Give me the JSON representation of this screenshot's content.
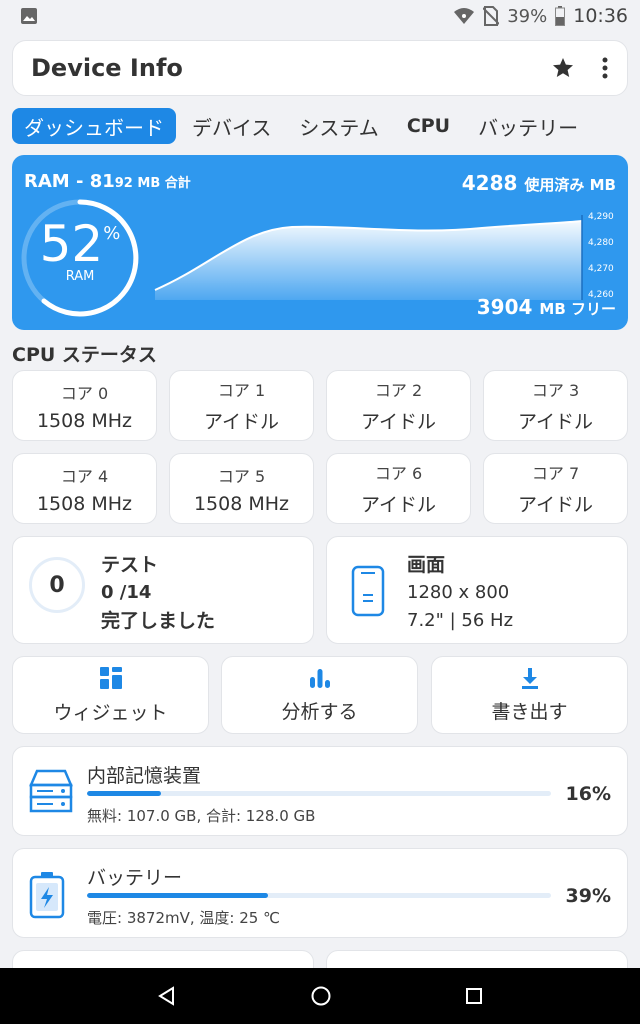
{
  "status_bar": {
    "battery": "39%",
    "time": "10:36"
  },
  "app": {
    "title": "Device Info"
  },
  "tabs": [
    {
      "label": "ダッシュボード"
    },
    {
      "label": "デバイス"
    },
    {
      "label": "システム"
    },
    {
      "label": "CPU"
    },
    {
      "label": "バッテリー"
    }
  ],
  "ram": {
    "title_prefix": "RAM - 81",
    "title_small": "92 MB 合計",
    "used_value": "4288",
    "used_unit": "使用済み MB",
    "free_value": "3904",
    "free_unit": "MB フリー",
    "percent": "52",
    "percent_sign": "%",
    "gauge_label": "RAM",
    "accent": "#2f98ee"
  },
  "chart_data": {
    "type": "area",
    "y_ticks": [
      "4,290",
      "4,280",
      "4,270",
      "4,260"
    ],
    "ylim": [
      4260,
      4290
    ]
  },
  "cpu": {
    "section_title": "CPU ステータス",
    "cores": [
      {
        "name": "コア 0",
        "value": "1508 MHz"
      },
      {
        "name": "コア 1",
        "value": "アイドル"
      },
      {
        "name": "コア 2",
        "value": "アイドル"
      },
      {
        "name": "コア 3",
        "value": "アイドル"
      },
      {
        "name": "コア 4",
        "value": "1508 MHz"
      },
      {
        "name": "コア 5",
        "value": "1508 MHz"
      },
      {
        "name": "コア 6",
        "value": "アイドル"
      },
      {
        "name": "コア 7",
        "value": "アイドル"
      }
    ]
  },
  "test": {
    "ring_value": "0",
    "title": "テスト",
    "count": "0 /14",
    "status": "完了しました"
  },
  "screen": {
    "title": "画面",
    "resolution": "1280 x 800",
    "details": "7.2\" | 56 Hz"
  },
  "actions": [
    {
      "label": "ウィジェット",
      "icon": "widget-icon"
    },
    {
      "label": "分析する",
      "icon": "chart-icon"
    },
    {
      "label": "書き出す",
      "icon": "download-icon"
    }
  ],
  "storage": {
    "name": "内部記憶装置",
    "detail": "無料: 107.0 GB,  合計: 128.0 GB",
    "percent": "16%",
    "fill": 0.16
  },
  "battery": {
    "name": "バッテリー",
    "detail": "電圧: 3872mV, 温度: 25 ℃",
    "percent": "39%",
    "fill": 0.39
  }
}
